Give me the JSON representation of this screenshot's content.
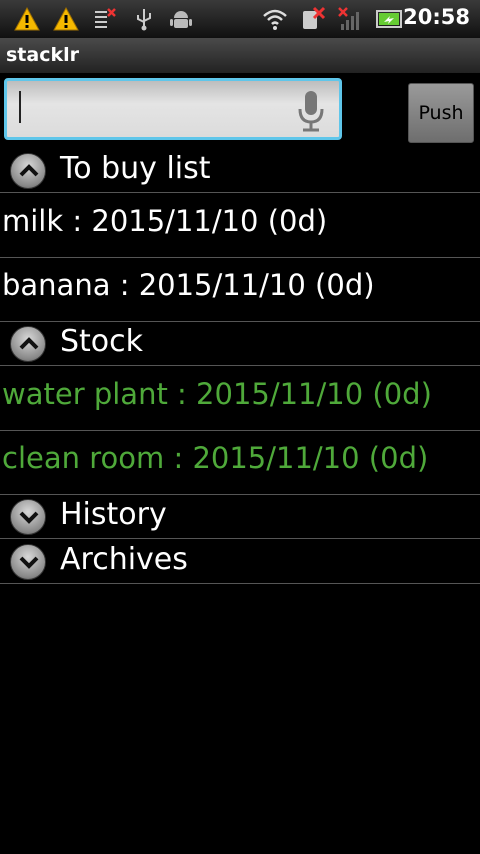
{
  "status_bar": {
    "icons": [
      "warning-icon",
      "warning-icon",
      "sync-error-icon",
      "usb-icon",
      "android-debug-icon",
      "wifi-icon",
      "no-sim-icon",
      "no-signal-icon",
      "battery-icon"
    ],
    "time": "20:58",
    "warning_color": "#f5b800"
  },
  "app": {
    "title": "stacklr"
  },
  "input": {
    "value": "",
    "placeholder": "",
    "mic_icon": "microphone-icon"
  },
  "push_button": {
    "label": "Push"
  },
  "groups": [
    {
      "label": "To buy list",
      "expanded": true,
      "toggle_icon": "chevron-up-icon",
      "items": [
        "milk : 2015/11/10 (0d)",
        "banana : 2015/11/10 (0d)"
      ],
      "item_color": "#ffffff"
    },
    {
      "label": "Stock",
      "expanded": true,
      "toggle_icon": "chevron-up-icon",
      "items": [
        "water plant : 2015/11/10 (0d)",
        "clean room : 2015/11/10 (0d)"
      ],
      "item_color": "#4fa93a"
    },
    {
      "label": "History",
      "expanded": false,
      "toggle_icon": "chevron-down-icon",
      "items": []
    },
    {
      "label": "Archives",
      "expanded": false,
      "toggle_icon": "chevron-down-icon",
      "items": []
    }
  ]
}
